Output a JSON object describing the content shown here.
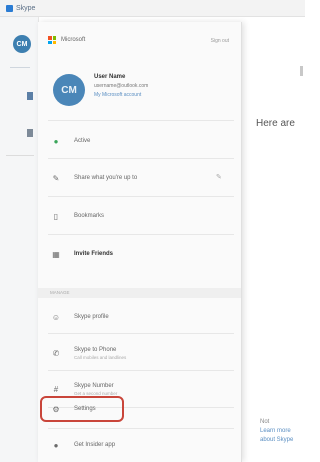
{
  "window": {
    "title": "Skype"
  },
  "rail": {
    "avatar_initials": "CM"
  },
  "background": {
    "partial_heading": "Here are",
    "footer_line1": "Not",
    "footer_line2": "Learn more about Skype"
  },
  "panel": {
    "brand": "Microsoft",
    "sign_out": "Sign out",
    "profile": {
      "initials": "CM",
      "name": "User Name",
      "email": "username@outlook.com",
      "link": "My Microsoft account"
    },
    "items": [
      {
        "icon": "status-icon",
        "glyph": "●",
        "label": "Active",
        "sub": ""
      },
      {
        "icon": "mood-icon",
        "glyph": "✎",
        "label": "Share what you're up to",
        "sub": ""
      },
      {
        "icon": "bookmark-icon",
        "glyph": "▯",
        "label": "Bookmarks",
        "sub": ""
      },
      {
        "icon": "invite-icon",
        "glyph": "▦",
        "label": "Invite Friends",
        "sub": ""
      }
    ],
    "section_label": "MANAGE",
    "manage_items": [
      {
        "icon": "profile-icon",
        "glyph": "☺",
        "label": "Skype profile",
        "sub": ""
      },
      {
        "icon": "phone-icon",
        "glyph": "✆",
        "label": "Skype to Phone",
        "sub": "Call mobiles and landlines"
      },
      {
        "icon": "number-icon",
        "glyph": "#",
        "label": "Skype Number",
        "sub": "Get a second number"
      },
      {
        "icon": "gear-icon",
        "glyph": "⚙",
        "label": "Settings",
        "sub": ""
      },
      {
        "icon": "lightbulb-icon",
        "glyph": "●",
        "label": "Get Insider app",
        "sub": ""
      }
    ]
  }
}
